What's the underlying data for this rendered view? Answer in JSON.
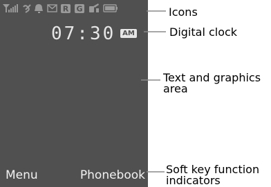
{
  "status_icons": [
    {
      "name": "signal-strength-icon"
    },
    {
      "name": "missed-call-icon"
    },
    {
      "name": "alarm-bell-icon"
    },
    {
      "name": "message-envelope-icon"
    },
    {
      "name": "roaming-r-icon",
      "text": "R"
    },
    {
      "name": "gprs-g-icon",
      "text": "G"
    },
    {
      "name": "silent-mode-icon"
    },
    {
      "name": "battery-icon"
    }
  ],
  "clock": {
    "time": "07:30",
    "ampm": "AM"
  },
  "softkeys": {
    "left": "Menu",
    "right": "Phonebook"
  },
  "callouts": {
    "icons": "Icons",
    "clock": "Digital clock",
    "area": "Text and graphics area",
    "softkey": "Soft key function indicators"
  },
  "colors": {
    "screen": "#505050",
    "foreground": "#e6e6e6",
    "leader": "#8a8a8a"
  }
}
